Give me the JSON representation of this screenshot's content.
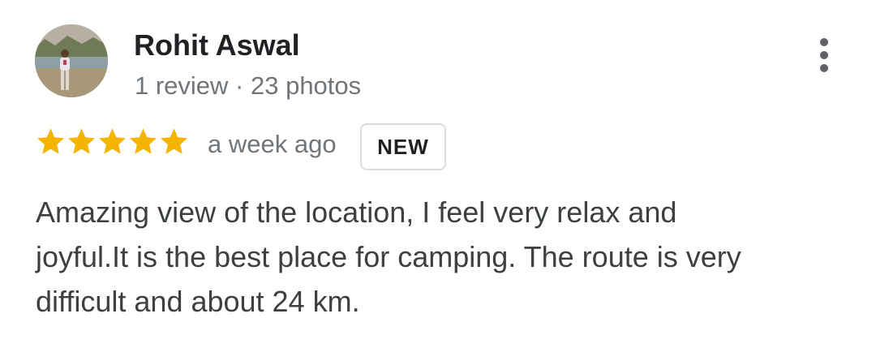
{
  "review": {
    "author": {
      "name": "Rohit Aswal",
      "stats": "1 review · 23 photos"
    },
    "rating": 5,
    "star_color": "#F4B400",
    "time_ago": "a week ago",
    "badge": "NEW",
    "text": "Amazing view of the location, I feel very relax and joyful.It is the best place for camping. The route is very difficult and about 24 km."
  },
  "icons": {
    "avatar": "profile-photo",
    "more": "more-vertical-icon",
    "star": "star-icon"
  }
}
